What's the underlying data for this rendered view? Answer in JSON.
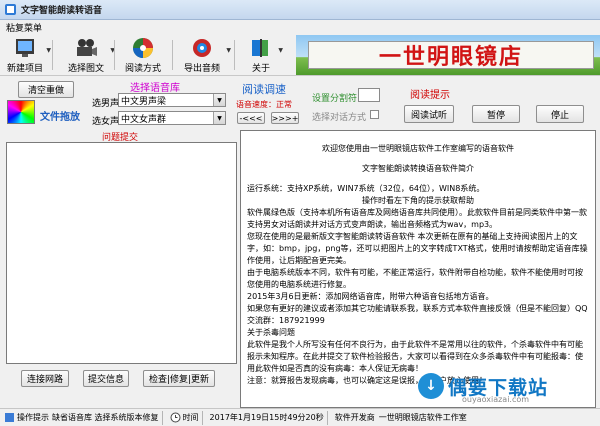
{
  "window": {
    "title": "文字智能朗读转语音"
  },
  "menubar": {
    "menu": "粘复菜单"
  },
  "toolbar": {
    "new_project": "新建项目",
    "select_text": "选择图文",
    "read_mode": "阅读方式",
    "export_audio": "导出音频",
    "about": "关于"
  },
  "banner": {
    "text": "一世明眼镜店"
  },
  "controls": {
    "clear_button": "清空重做",
    "drag_label": "文件拖放",
    "voice_lib_label": "选择语音库",
    "male_label": "选男声",
    "male_value": "中文男声梁",
    "female_label": "选女声",
    "female_value": "中文女声群",
    "speed_title": "阅读调速",
    "speed_status": "语音速度：正常",
    "speed_down": "-<<<",
    "speed_up": ">>>+",
    "segment_label": "设置分割符",
    "select_dialog_label": "选择对话方式",
    "read_tip": "阅读提示",
    "listen_button": "阅读试听",
    "pause_button": "暂停",
    "stop_button": "停止"
  },
  "left_panel": {
    "title": "问题提交",
    "connect_button": "连接网路",
    "submit_button": "提交信息",
    "check_button": "检查|修复|更新"
  },
  "right_panel": {
    "lines": [
      "欢迎您使用由一世明眼镜店软件工作室编写的语音软件",
      "文字智能朗读转换语音软件简介",
      "运行系统：支持XP系统，WIN7系统（32位，64位），WIN8系统。",
      "操作时看左下角的提示获取帮助",
      "软件属绿色版（支持本机所有语音库及网络语音库共同使用）。此款软件目前是同类软件中第一款支持男女对话朗读并对话方式变声朗读，输出音频格式为wav，mp3。",
      "您现在使用的是最新版文字智能朗读转语音软件 本次更新在原有的基础上支持阅读图片上的文字，如：bmp，jpg，png等，还可以把图片上的文字转成TXT格式，使用时请按帮助定语音库操作使用，让后期配音更完美。",
      "由于电脑系统版本不同，软件有可能，不能正常运行，软件附带自检功能，软件不能使用时可按您使用的电脑系统进行修复。",
      "2015年3月6日更新：添加网络语音库，附带六种语音包括地方语音。",
      "如果您有更好的建议或者添加其它功能请联系我，联系方式本软件直接反馈（但是不能回复）QQ交流群：187921999",
      "关于杀毒问题",
      "此软件是我个人所写没有任何不良行为，由于此软件不是常用以往的软件，个杀毒软件中有可能报示未知程序。在此并提交了软件检验报告，大家可以看得到在众多杀毒软件中有可能报毒：使用此软件如是否真的没有病毒：本人保证无病毒！",
      "注意：就算报告发现病毒，也可以确定这是误报，请用户放心使用！"
    ]
  },
  "statusbar": {
    "tip_label": "操作提示",
    "tip_text": "缺省语音库 选择系统版本修复",
    "time_label": "时间",
    "time_value": "2017年1月19日15时49分20秒",
    "dev_label": "软件开发商",
    "dev_value": "一世明眼镜店软件工作室"
  },
  "watermark": {
    "title": "偶要下载站",
    "subtitle": "ouyaoxiazai.com"
  }
}
